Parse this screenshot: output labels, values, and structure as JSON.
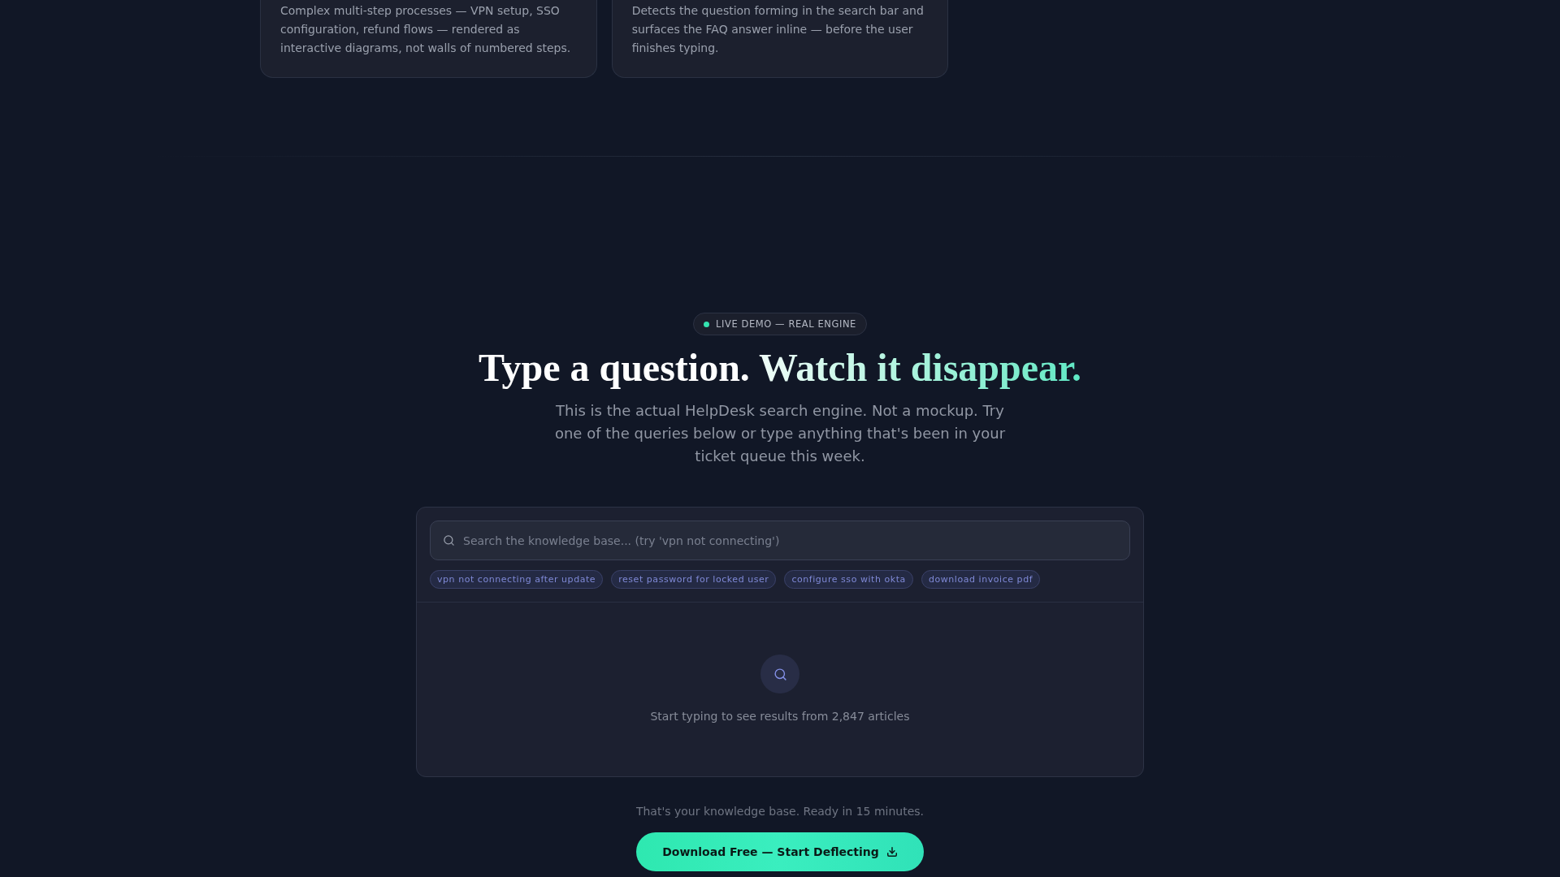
{
  "feature_cards": [
    {
      "description": "Complex multi-step processes — VPN setup, SSO configuration, refund flows — rendered as interactive diagrams, not walls of numbered steps."
    },
    {
      "description": "Detects the question forming in the search bar and surfaces the FAQ answer inline — before the user finishes typing."
    }
  ],
  "demo": {
    "badge": {
      "label": "LIVE DEMO — REAL ENGINE"
    },
    "heading": {
      "text": "Type a question.",
      "highlight": "Watch it disappear."
    },
    "description": "This is the actual HelpDesk search engine. Not a mockup. Try one of the queries below or type anything that's been in your ticket queue this week.",
    "search": {
      "placeholder": "Search the knowledge base... (try 'vpn not connecting')",
      "suggestions": [
        "vpn not connecting after update",
        "reset password for locked user",
        "configure sso with okta",
        "download invoice pdf"
      ]
    },
    "empty_state": {
      "message": "Start typing to see results from 2,847 articles"
    }
  },
  "footer_note": "That's your knowledge base. Ready in 15 minutes.",
  "cta_button": {
    "label": "Download Free — Start Deflecting"
  }
}
